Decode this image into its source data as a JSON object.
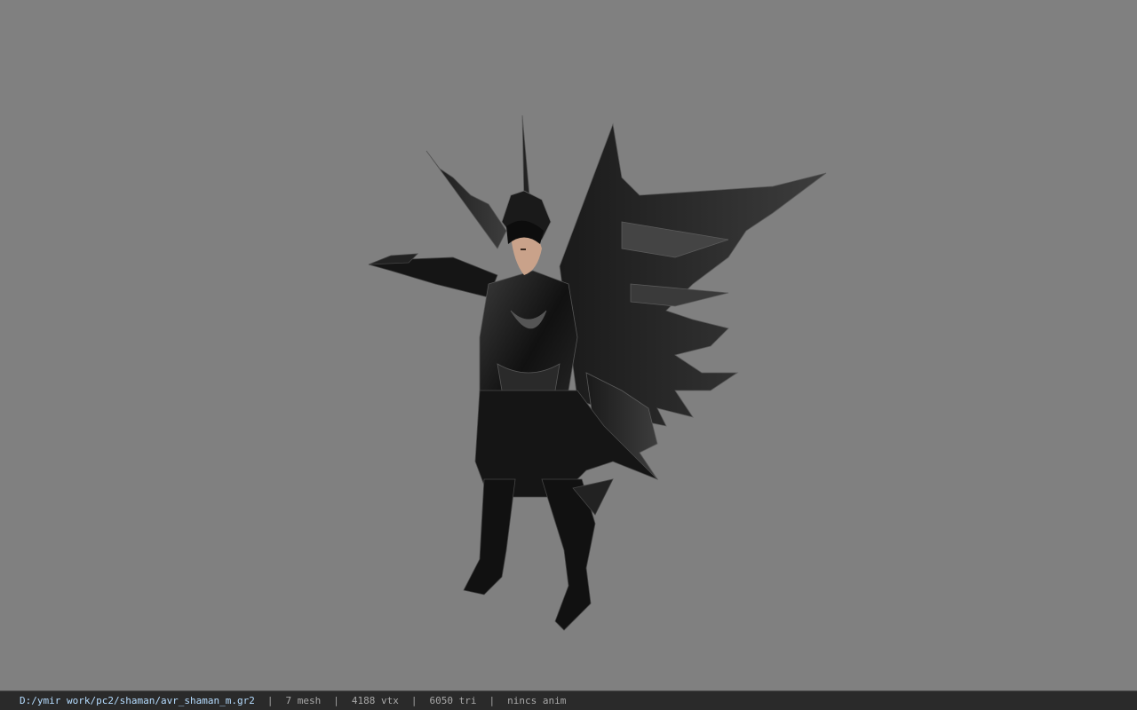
{
  "viewport": {
    "background_color": "#808080",
    "model_description_icon": "character-model-icon"
  },
  "status_bar": {
    "path": "D:/ymir work/pc2/shaman/avr_shaman_m.gr2",
    "mesh": "7 mesh",
    "vertices": "4188 vtx",
    "triangles": "6050 tri",
    "animation": "nincs anim",
    "separator": "|",
    "path_color": "#b5dcff",
    "text_color": "#a8a8a8"
  }
}
